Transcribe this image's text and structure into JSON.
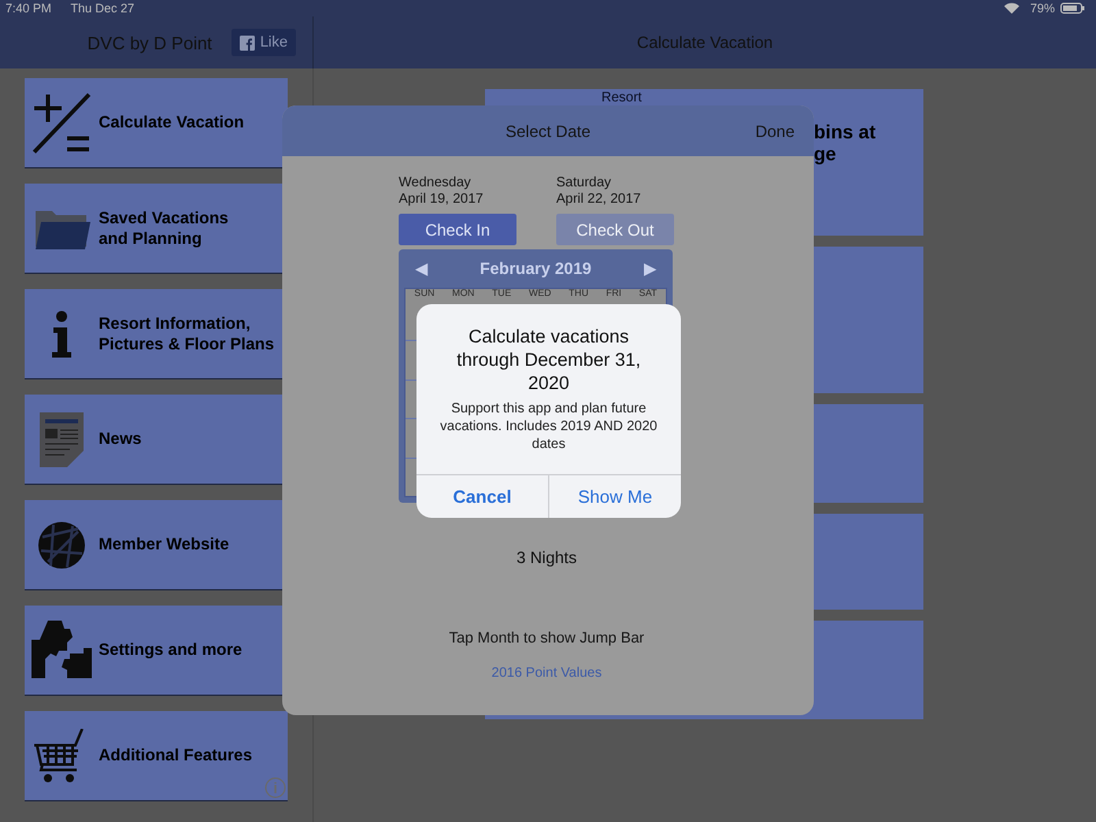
{
  "status_bar": {
    "time": "7:40 PM",
    "date": "Thu Dec 27",
    "battery": "79%"
  },
  "header": {
    "app_title": "DVC by D Point",
    "like_button": "Like",
    "title": "Calculate Vacation"
  },
  "menu": [
    {
      "label": "Calculate Vacation"
    },
    {
      "label": "Saved Vacations and Planning"
    },
    {
      "label": "Resort Information, Pictures & Floor Plans"
    },
    {
      "label": "News"
    },
    {
      "label": "Member Website"
    },
    {
      "label": "Settings and more"
    },
    {
      "label": "Additional Features"
    }
  ],
  "content": {
    "tile_texts": [
      "Resort",
      "bins at",
      "ge"
    ]
  },
  "date_sheet": {
    "title": "Select Date",
    "done": "Done",
    "dates": [
      {
        "weekday": "Wednesday",
        "date": "April 19, 2017",
        "button": "Check In",
        "disabled": false
      },
      {
        "weekday": "Saturday",
        "date": "April 22, 2017",
        "button": "Check Out",
        "disabled": true
      }
    ],
    "calendar": {
      "month": "February 2019",
      "prev": "◀",
      "next": "▶",
      "weekdays": [
        "SUN",
        "MON",
        "TUE",
        "WED",
        "THU",
        "FRI",
        "SAT"
      ]
    },
    "nights": "3 Nights",
    "hint": "Tap Month to show Jump Bar",
    "link": "2016 Point Values"
  },
  "alert": {
    "title": "Calculate vacations through December 31, 2020",
    "message": "Support this app and plan future vacations.  Includes 2019 AND 2020 dates",
    "buttons": [
      {
        "label": "Cancel",
        "kind": "cancel"
      },
      {
        "label": "Show Me",
        "kind": "default"
      }
    ]
  }
}
